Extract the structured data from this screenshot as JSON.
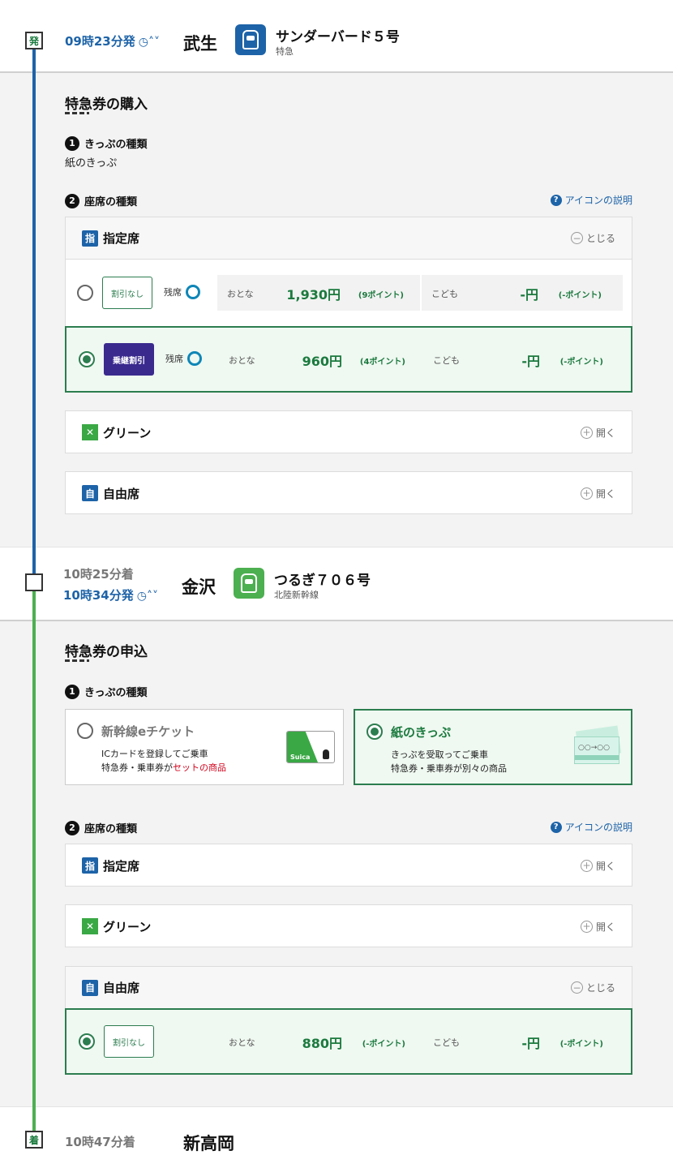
{
  "departure": {
    "marker": "発",
    "time": "09時23分発",
    "station": "武生",
    "train_name": "サンダーバード５号",
    "train_type": "特急"
  },
  "section1": {
    "title": "特急券の購入",
    "step1_num": "1",
    "step1_label": "きっぷの種類",
    "ticket_type": "紙のきっぷ",
    "step2_num": "2",
    "step2_label": "座席の種類",
    "help": "アイコンの説明",
    "reserved": {
      "icon": "指",
      "label": "指定席",
      "toggle": "とじる",
      "fares": [
        {
          "discount": "割引なし",
          "remain": "残席",
          "adult_label": "おとな",
          "adult_price": "1,930円",
          "adult_points": "(9ポイント)",
          "child_label": "こども",
          "child_price": "-円",
          "child_points": "(-ポイント)"
        },
        {
          "discount": "乗継割引",
          "remain": "残席",
          "adult_label": "おとな",
          "adult_price": "960円",
          "adult_points": "(4ポイント)",
          "child_label": "こども",
          "child_price": "-円",
          "child_points": "(-ポイント)"
        }
      ]
    },
    "green": {
      "label": "グリーン",
      "toggle": "開く"
    },
    "free": {
      "icon": "自",
      "label": "自由席",
      "toggle": "開く"
    }
  },
  "transfer": {
    "arrive": "10時25分着",
    "depart": "10時34分発",
    "station": "金沢",
    "train_name": "つるぎ７０６号",
    "train_type": "北陸新幹線"
  },
  "section2": {
    "title": "特急券の申込",
    "step1_num": "1",
    "step1_label": "きっぷの種類",
    "eticket": {
      "title": "新幹線eチケット",
      "desc1": "ICカードを登録してご乗車",
      "desc2a": "特急券・乗車券が",
      "desc2b": "セットの商品",
      "card_text": "Suica"
    },
    "paper": {
      "title": "紙のきっぷ",
      "desc1": "きっぷを受取ってご乗車",
      "desc2": "特急券・乗車券が別々の商品",
      "ticket_text": "○○→○○"
    },
    "step2_num": "2",
    "step2_label": "座席の種類",
    "help": "アイコンの説明",
    "reserved": {
      "icon": "指",
      "label": "指定席",
      "toggle": "開く"
    },
    "green": {
      "label": "グリーン",
      "toggle": "開く"
    },
    "free": {
      "icon": "自",
      "label": "自由席",
      "toggle": "とじる",
      "fare": {
        "discount": "割引なし",
        "adult_label": "おとな",
        "adult_price": "880円",
        "adult_points": "(-ポイント)",
        "child_label": "こども",
        "child_price": "-円",
        "child_points": "(-ポイント)"
      }
    }
  },
  "arrival": {
    "marker": "着",
    "time": "10時47分着",
    "station": "新高岡"
  },
  "icons": {
    "clock": "clock-icon",
    "sort": "chevron-updown-icon",
    "plus": "plus-circle-icon",
    "minus": "minus-circle-icon",
    "help": "question-icon"
  },
  "colors": {
    "line_blue": "#1d63a8",
    "line_green": "#4caf50",
    "accent_green": "#1b7a3e",
    "discount_purple": "#3a2a8e",
    "remain_ring": "#0e86b7"
  }
}
